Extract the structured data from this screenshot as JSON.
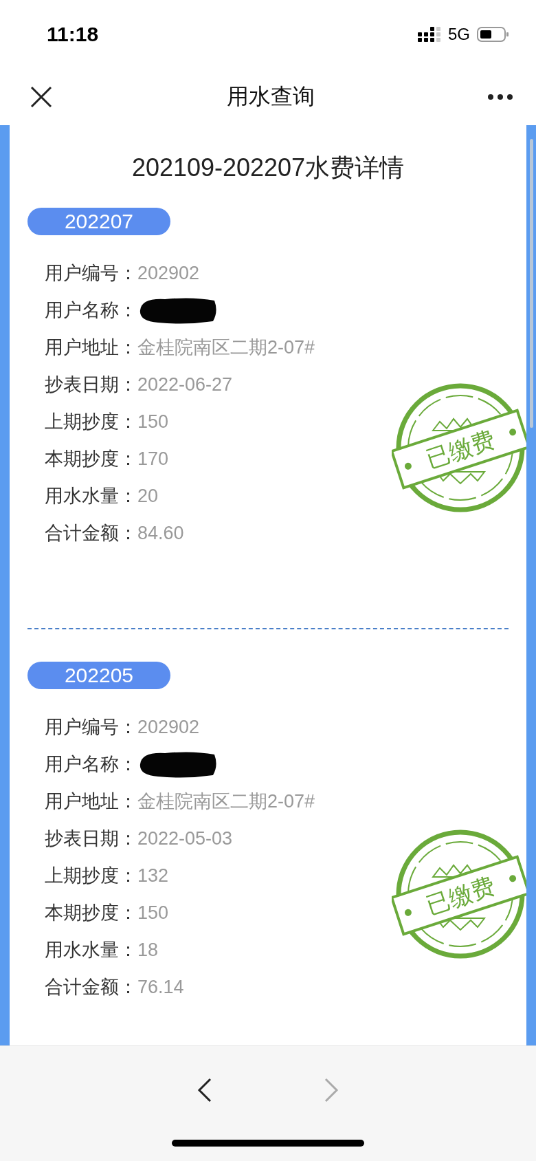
{
  "status_bar": {
    "time": "11:18",
    "network": "5G"
  },
  "nav_bar": {
    "title": "用水查询"
  },
  "page_title": "202109-202207水费详情",
  "records": [
    {
      "period": "202207",
      "paid": true,
      "stamp": "已缴费",
      "fields": [
        {
          "label": "用户编号：",
          "value": "202902"
        },
        {
          "label": "用户名称：",
          "redacted": true
        },
        {
          "label": "用户地址：",
          "value": "金桂院南区二期2-07#"
        },
        {
          "label": "抄表日期：",
          "value": "2022-06-27"
        },
        {
          "label": "上期抄度：",
          "value": "150"
        },
        {
          "label": "本期抄度：",
          "value": "170"
        },
        {
          "label": "用水水量：",
          "value": "20"
        },
        {
          "label": "合计金额：",
          "value": "84.60"
        }
      ]
    },
    {
      "period": "202205",
      "paid": true,
      "stamp": "已缴费",
      "fields": [
        {
          "label": "用户编号：",
          "value": "202902"
        },
        {
          "label": "用户名称：",
          "redacted": true
        },
        {
          "label": "用户地址：",
          "value": "金桂院南区二期2-07#"
        },
        {
          "label": "抄表日期：",
          "value": "2022-05-03"
        },
        {
          "label": "上期抄度：",
          "value": "132"
        },
        {
          "label": "本期抄度：",
          "value": "150"
        },
        {
          "label": "用水水量：",
          "value": "18"
        },
        {
          "label": "合计金额：",
          "value": "76.14"
        }
      ]
    }
  ],
  "footer": {
    "back_disabled": false,
    "forward_disabled": true
  }
}
